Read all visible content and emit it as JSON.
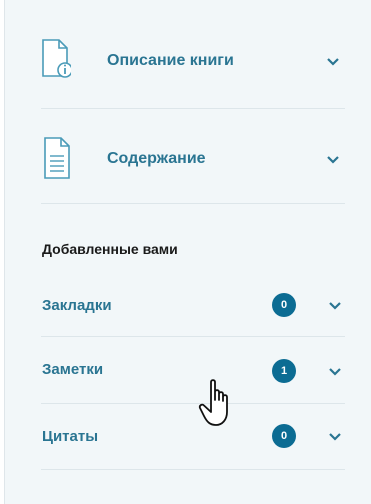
{
  "panel": {
    "book_description": {
      "label": "Описание книги",
      "icon": "document-info-icon"
    },
    "contents": {
      "label": "Содержание",
      "icon": "document-list-icon"
    },
    "added_section": {
      "title": "Добавленные вами",
      "items": [
        {
          "label": "Закладки",
          "count": "0"
        },
        {
          "label": "Заметки",
          "count": "1"
        },
        {
          "label": "Цитаты",
          "count": "0"
        }
      ]
    }
  },
  "colors": {
    "label": "#2a7592",
    "badge": "#0c6c93",
    "panel_bg": "#f2f7f9",
    "icon": "#4a9bb8"
  }
}
